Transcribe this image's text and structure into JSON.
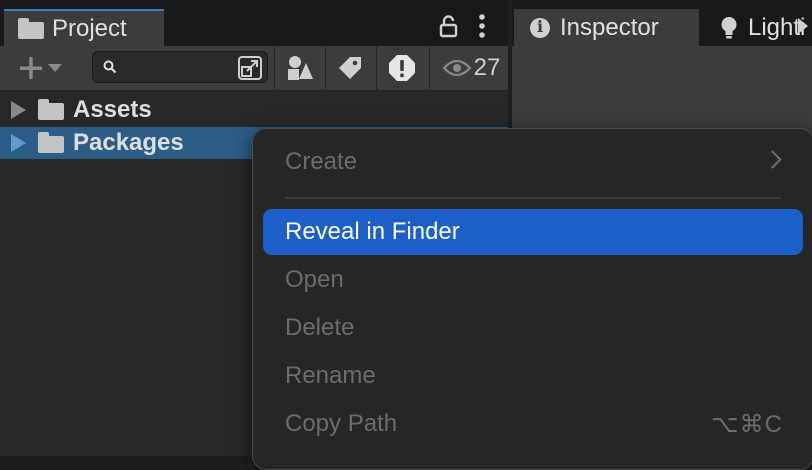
{
  "project": {
    "tab_label": "Project",
    "hidden_count": "27",
    "search": {
      "value": "",
      "placeholder": ""
    },
    "tree": [
      {
        "name": "Assets",
        "selected": false
      },
      {
        "name": "Packages",
        "selected": true
      }
    ]
  },
  "inspector": {
    "tab_label": "Inspector",
    "next_tab_label": "Lighting"
  },
  "context_menu": {
    "items": [
      {
        "label": "Create",
        "enabled": false,
        "submenu": true
      },
      {
        "label": "Reveal in Finder",
        "enabled": true,
        "highlighted": true
      },
      {
        "label": "Open",
        "enabled": false
      },
      {
        "label": "Delete",
        "enabled": false
      },
      {
        "label": "Rename",
        "enabled": false
      },
      {
        "label": "Copy Path",
        "enabled": false,
        "shortcut": "⌥⌘C"
      }
    ]
  },
  "colors": {
    "accent": "#1b5fc7",
    "selection": "#2c5d87",
    "tab_highlight": "#3a79bb"
  },
  "icons": [
    "folder-icon",
    "lock-icon",
    "kebab-menu-icon",
    "plus-icon",
    "search-icon",
    "search-popout-icon",
    "filter-by-type-icon",
    "filter-by-label-icon",
    "error-filter-icon",
    "eye-icon",
    "info-icon",
    "lightbulb-icon"
  ]
}
